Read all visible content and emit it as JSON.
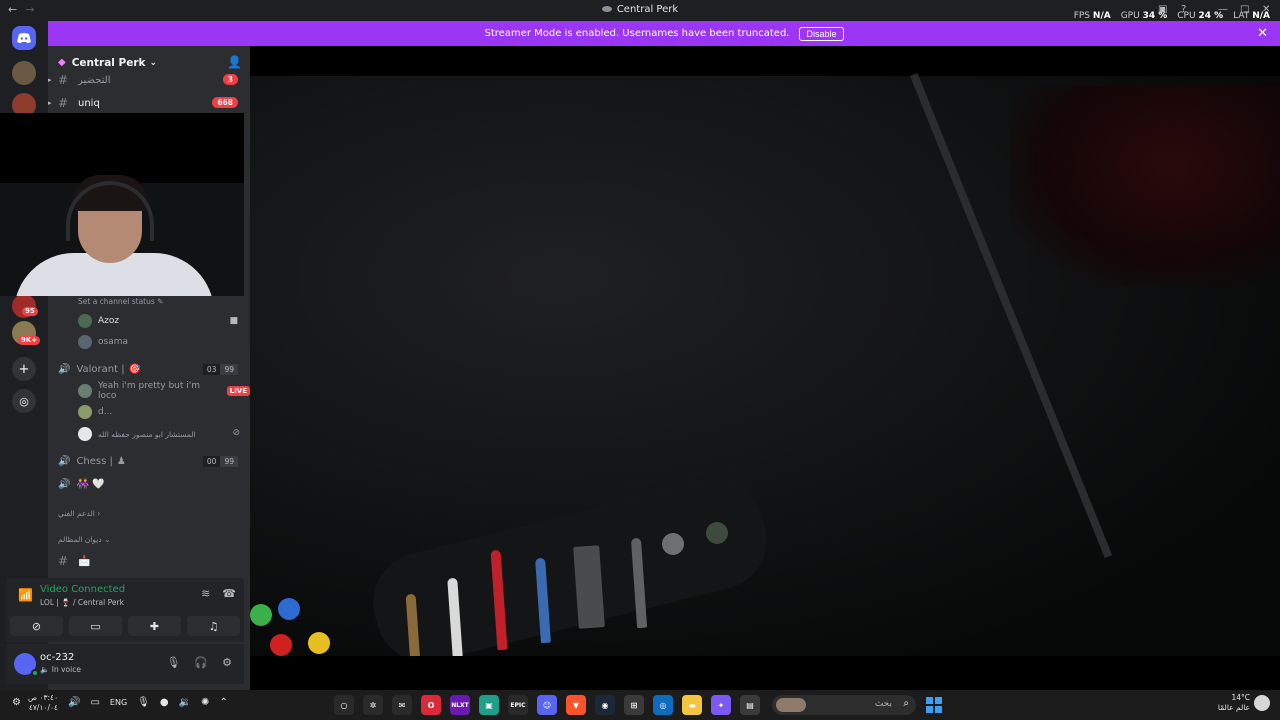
{
  "titlebar": {
    "back": "←",
    "forward": "→",
    "title": "Central Perk",
    "stats": [
      {
        "label": "FPS",
        "value": "N/A"
      },
      {
        "label": "GPU",
        "value": "34 %"
      },
      {
        "label": "CPU",
        "value": "24 %"
      },
      {
        "label": "LAT",
        "value": "N/A"
      }
    ]
  },
  "banner": {
    "text": "Streamer Mode is enabled. Usernames have been truncated.",
    "button": "Disable",
    "close": "✕"
  },
  "rail": {
    "badges": [
      "95",
      "9K+"
    ]
  },
  "server": {
    "name": "Central Perk",
    "chevron": "⌄"
  },
  "channels": [
    {
      "name": "التحضير",
      "badge": "3"
    },
    {
      "name": "uniq",
      "badge": "668"
    }
  ],
  "channel_status": "Set a channel status",
  "voice_channels": [
    {
      "name": "",
      "users": [
        {
          "name": "Azoz",
          "color": "#dbdee1"
        },
        {
          "name": "osama",
          "color": "#949ba4"
        }
      ]
    },
    {
      "name": "Valorant |",
      "limit_a": "03",
      "limit_b": "99",
      "users": [
        {
          "name": "Yeah i'm pretty but i'm loco",
          "live": "LIVE"
        },
        {
          "name": "d..."
        },
        {
          "name": "المستشار ابو منصور حفظه الله"
        }
      ]
    },
    {
      "name": "Chess |",
      "limit_a": "00",
      "limit_b": "99"
    }
  ],
  "categories": [
    "الدعم الفني",
    "ديوان المظالم"
  ],
  "voice_panel": {
    "title": "Video Connected",
    "subtitle": "LOL | 🍷 / Central Perk"
  },
  "user": {
    "name": "oc-232",
    "status": "In voice"
  },
  "taskbar": {
    "clock_time": "٠٣:٤٠ ص",
    "clock_date": "٤٧/١٠/٠٤",
    "lang": "ENG",
    "search_label": "بحث",
    "weather_temp": "14°C",
    "weather_label": "عالم عالمًا",
    "apps": [
      "NLXT",
      "EPIC"
    ]
  },
  "colors": {
    "banner": "#9b36f5",
    "live": "#ed4245",
    "connected": "#23a55a"
  }
}
